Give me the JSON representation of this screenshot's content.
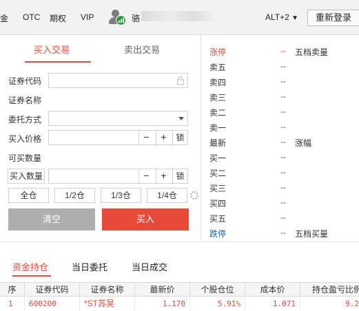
{
  "menu": {
    "items": [
      "金",
      "OTC",
      "期权",
      "VIP"
    ]
  },
  "user": {
    "name_visible": "骆"
  },
  "toolbar": {
    "hotkey_selected": "ALT+2",
    "relogin_label": "重新登录"
  },
  "trade_tabs": {
    "buy": "买入交易",
    "sell": "卖出交易"
  },
  "form": {
    "code_label": "证券代码",
    "code_value": "",
    "name_label": "证券名称",
    "name_value": "",
    "order_type_label": "委托方式",
    "order_type_value": "",
    "price_label": "买入价格",
    "price_value": "",
    "minus": "−",
    "plus": "+",
    "lock": "锁",
    "buyable_label": "可买数量",
    "buyable_value": "",
    "qty_button": "买入数量",
    "qty_value": "",
    "positions": [
      "全仓",
      "1/2仓",
      "1/3仓",
      "1/4仓"
    ],
    "clear_label": "清空",
    "buy_label": "买入"
  },
  "order_book": {
    "rows": [
      {
        "label": "涨停",
        "value": "--",
        "extra": "五档卖量"
      },
      {
        "label": "卖五",
        "value": "--",
        "extra": ""
      },
      {
        "label": "卖四",
        "value": "--",
        "extra": ""
      },
      {
        "label": "卖三",
        "value": "--",
        "extra": ""
      },
      {
        "label": "卖二",
        "value": "--",
        "extra": ""
      },
      {
        "label": "卖一",
        "value": "--",
        "extra": ""
      },
      {
        "label": "最新",
        "value": "--",
        "extra": "涨幅"
      },
      {
        "label": "买一",
        "value": "--",
        "extra": ""
      },
      {
        "label": "买二",
        "value": "--",
        "extra": ""
      },
      {
        "label": "买三",
        "value": "--",
        "extra": ""
      },
      {
        "label": "买四",
        "value": "--",
        "extra": ""
      },
      {
        "label": "买五",
        "value": "--",
        "extra": ""
      },
      {
        "label": "跌停",
        "value": "--",
        "extra": "五档买量"
      }
    ],
    "limit_up_color": "#e84a3a",
    "limit_down_color": "#1a5fb4"
  },
  "bottom_tabs": [
    "资金持仓",
    "当日委托",
    "当日成交"
  ],
  "holdings": {
    "columns": [
      "序",
      "证券代码",
      "证券名称",
      "最新价",
      "个股仓位",
      "成本价",
      "持仓盈亏比例"
    ],
    "rows": [
      [
        "1",
        "600200",
        "*ST苏吴",
        "1.170",
        "5.91%",
        "1.071",
        "9.2"
      ]
    ]
  },
  "colors": {
    "accent": "#e84a3a",
    "clear_button": "#aeaeae"
  }
}
